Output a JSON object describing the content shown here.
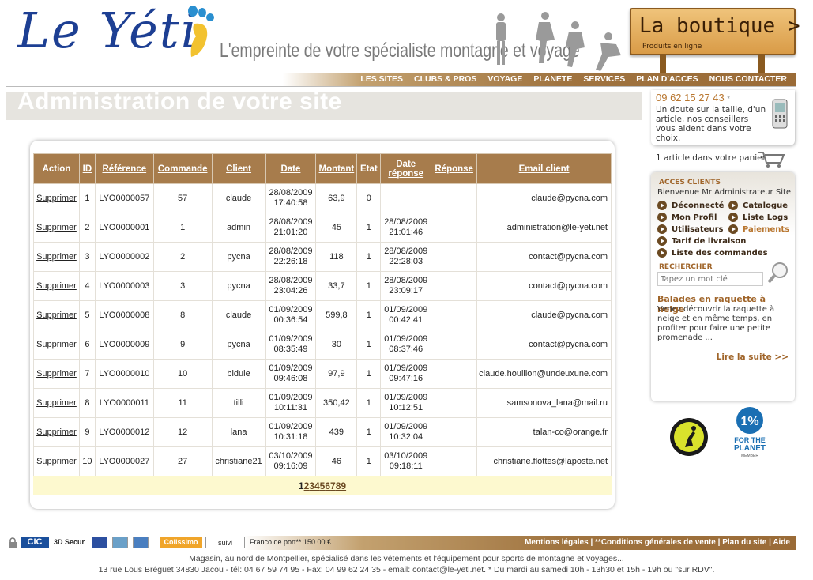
{
  "header": {
    "logo": "Le Yéti",
    "tagline": "L'empreinte de votre spécialiste montagne et voyage",
    "boutique_title": "La boutique >",
    "boutique_sub": "Produits en ligne"
  },
  "nav": [
    "LES SITES",
    "CLUBS & PROS",
    "VOYAGE",
    "PLANETE",
    "SERVICES",
    "PLAN D'ACCES",
    "NOUS CONTACTER"
  ],
  "page_title": "Administration de votre site",
  "table": {
    "headers": [
      "Action",
      "ID",
      "Référence",
      "Commande",
      "Client",
      "Date",
      "Montant",
      "Etat",
      "Date réponse",
      "Réponse",
      "Email client"
    ],
    "rows": [
      {
        "action": "Supprimer",
        "id": "1",
        "ref": "LYO0000057",
        "cmd": "57",
        "client": "claude",
        "date1": "28/08/2009",
        "date2": "17:40:58",
        "montant": "63,9",
        "etat": "0",
        "rdate1": "",
        "rdate2": "",
        "reponse": "",
        "email": "claude@pycna.com"
      },
      {
        "action": "Supprimer",
        "id": "2",
        "ref": "LYO0000001",
        "cmd": "1",
        "client": "admin",
        "date1": "28/08/2009",
        "date2": "21:01:20",
        "montant": "45",
        "etat": "1",
        "rdate1": "28/08/2009",
        "rdate2": "21:01:46",
        "reponse": "",
        "email": "administration@le-yeti.net"
      },
      {
        "action": "Supprimer",
        "id": "3",
        "ref": "LYO0000002",
        "cmd": "2",
        "client": "pycna",
        "date1": "28/08/2009",
        "date2": "22:26:18",
        "montant": "118",
        "etat": "1",
        "rdate1": "28/08/2009",
        "rdate2": "22:28:03",
        "reponse": "",
        "email": "contact@pycna.com"
      },
      {
        "action": "Supprimer",
        "id": "4",
        "ref": "LYO0000003",
        "cmd": "3",
        "client": "pycna",
        "date1": "28/08/2009",
        "date2": "23:04:26",
        "montant": "33,7",
        "etat": "1",
        "rdate1": "28/08/2009",
        "rdate2": "23:09:17",
        "reponse": "",
        "email": "contact@pycna.com"
      },
      {
        "action": "Supprimer",
        "id": "5",
        "ref": "LYO0000008",
        "cmd": "8",
        "client": "claude",
        "date1": "01/09/2009",
        "date2": "00:36:54",
        "montant": "599,8",
        "etat": "1",
        "rdate1": "01/09/2009",
        "rdate2": "00:42:41",
        "reponse": "",
        "email": "claude@pycna.com"
      },
      {
        "action": "Supprimer",
        "id": "6",
        "ref": "LYO0000009",
        "cmd": "9",
        "client": "pycna",
        "date1": "01/09/2009",
        "date2": "08:35:49",
        "montant": "30",
        "etat": "1",
        "rdate1": "01/09/2009",
        "rdate2": "08:37:46",
        "reponse": "",
        "email": "contact@pycna.com"
      },
      {
        "action": "Supprimer",
        "id": "7",
        "ref": "LYO0000010",
        "cmd": "10",
        "client": "bidule",
        "date1": "01/09/2009",
        "date2": "09:46:08",
        "montant": "97,9",
        "etat": "1",
        "rdate1": "01/09/2009",
        "rdate2": "09:47:16",
        "reponse": "",
        "email": "claude.houillon@undeuxune.com"
      },
      {
        "action": "Supprimer",
        "id": "8",
        "ref": "LYO0000011",
        "cmd": "11",
        "client": "tilli",
        "date1": "01/09/2009",
        "date2": "10:11:31",
        "montant": "350,42",
        "etat": "1",
        "rdate1": "01/09/2009",
        "rdate2": "10:12:51",
        "reponse": "",
        "email": "samsonova_lana@mail.ru"
      },
      {
        "action": "Supprimer",
        "id": "9",
        "ref": "LYO0000012",
        "cmd": "12",
        "client": "lana",
        "date1": "01/09/2009",
        "date2": "10:31:18",
        "montant": "439",
        "etat": "1",
        "rdate1": "01/09/2009",
        "rdate2": "10:32:04",
        "reponse": "",
        "email": "talan-co@orange.fr"
      },
      {
        "action": "Supprimer",
        "id": "10",
        "ref": "LYO0000027",
        "cmd": "27",
        "client": "christiane21",
        "date1": "03/10/2009",
        "date2": "09:16:09",
        "montant": "46",
        "etat": "1",
        "rdate1": "03/10/2009",
        "rdate2": "09:18:11",
        "reponse": "",
        "email": "christiane.flottes@laposte.net"
      }
    ]
  },
  "pager": {
    "current": "1",
    "pages": [
      "2",
      "3",
      "4",
      "5",
      "6",
      "7",
      "8",
      "9"
    ]
  },
  "sidebar": {
    "phone": "09 62 15 27 43",
    "phone_star": "*",
    "phone_text": "Un doute sur la taille, d'un article, nos conseillers vous aident dans votre choix.",
    "cart": "1 article dans votre panier",
    "clients_title": "ACCES CLIENTS",
    "welcome": "Bienvenue Mr Administrateur Site",
    "menu": {
      "deconnecte": "Déconnecté",
      "catalogue": "Catalogue",
      "profil": "Mon Profil",
      "logs": "Liste Logs",
      "utilisateurs": "Utilisateurs",
      "paiements": "Paiements",
      "tarif": "Tarif de livraison",
      "commandes": "Liste des commandes"
    },
    "search_title": "RECHERCHER",
    "search_placeholder": "Tapez un mot clé",
    "balades_title": "Balades en raquette à neige",
    "balades_text": "Venez découvrir la raquette à neige et en même temps, en profiter pour faire une petite promenade ...",
    "lire": "Lire la suite >>",
    "badge2_line1": "FOR THE",
    "badge2_line2": "PLANET",
    "badge2_line3": "MEMBER"
  },
  "footer": {
    "cic": "CIC",
    "secure": "3D Secur",
    "colissimo": "Colissimo",
    "suivi": "suivi",
    "franco": "Franco de port** 150.00 €",
    "links": [
      "Mentions légales",
      "**Conditions générales de vente",
      "Plan du site",
      "Aide"
    ],
    "line1": "Magasin, au nord de Montpellier, spécialisé dans les vêtements et l'équipement pour sports de montagne et voyages...",
    "line2": "13 rue Lous Bréguet 34830 Jacou - tél: 04 67 59 74 95 - Fax: 04 99 62 24 35 - email: contact@le-yeti.net. * Du mardi au samedi 10h - 13h30 et 15h - 19h ou \"sur RDV\"."
  }
}
